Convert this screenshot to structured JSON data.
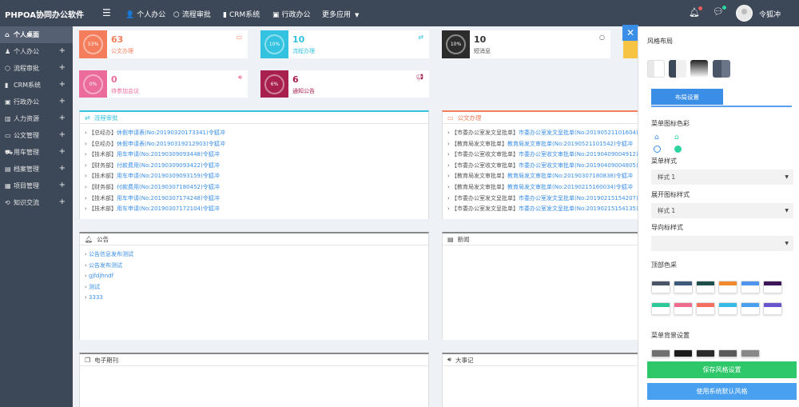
{
  "app": {
    "title": "PHPOA协同办公软件",
    "user": "令狐冲"
  },
  "topnav": [
    {
      "label": "个人办公",
      "icon": "user-icon"
    },
    {
      "label": "流程审批",
      "icon": "cube-icon"
    },
    {
      "label": "CRM系统",
      "icon": "bar-chart-icon"
    },
    {
      "label": "行政办公",
      "icon": "building-icon"
    },
    {
      "label": "更多应用",
      "icon": "caret-down-icon"
    }
  ],
  "sidebar": {
    "items": [
      {
        "label": "个人桌面"
      },
      {
        "label": "个人办公"
      },
      {
        "label": "流程审批"
      },
      {
        "label": "CRM系统"
      },
      {
        "label": "行政办公"
      },
      {
        "label": "人力资源"
      },
      {
        "label": "公文管理"
      },
      {
        "label": "用车管理"
      },
      {
        "label": "档案管理"
      },
      {
        "label": "项目管理"
      },
      {
        "label": "知识交流"
      }
    ]
  },
  "stats": [
    {
      "num": "63",
      "label": "公文办理",
      "pct": "53%"
    },
    {
      "num": "10",
      "label": "流程办理",
      "pct": "10%"
    },
    {
      "num": "10",
      "label": "短消息",
      "pct": "10%"
    },
    {
      "num": "0",
      "label": "待参加会议",
      "pct": "0%"
    },
    {
      "num": "6",
      "label": "通知公告",
      "pct": "6%"
    }
  ],
  "colors": {
    "orange": "#f47e5c",
    "cyan": "#33c3e0",
    "dark": "#2c2c2c",
    "pink": "#eb6b9b",
    "maroon": "#a8204e",
    "blue": "#3a8ee6",
    "green": "#2bd49e",
    "topbar": "#3c4757"
  },
  "panels": {
    "workflow": {
      "title": "流程审批",
      "items": [
        {
          "tag": "【总经办】",
          "text": "休假申请表(No:20190320173341)令狐冲"
        },
        {
          "tag": "【总经办】",
          "text": "休假申请表(No:20190319212903)令狐冲"
        },
        {
          "tag": "【技术部】",
          "text": "用车申请(No:20190309093448)令狐冲"
        },
        {
          "tag": "【财务部】",
          "text": "付款费用(No:20190309093422)令狐冲"
        },
        {
          "tag": "【技术部】",
          "text": "用车申请(No:20190309093159)令狐冲"
        },
        {
          "tag": "【财务部】",
          "text": "付款费用(No:20190307180452)令狐冲"
        },
        {
          "tag": "【技术部】",
          "text": "用车申请(No:20190307174248)令狐冲"
        },
        {
          "tag": "【技术部】",
          "text": "用车申请(No:20190307172104)令狐冲"
        }
      ]
    },
    "docs": {
      "title": "公文办理",
      "items": [
        {
          "tag": "【市委办公室发文呈批单】",
          "text": "市委办公室发文呈批单(No:20190521101604)令狐冲"
        },
        {
          "tag": "【教育局发文审批单】",
          "text": "教育局发文审批单(No:20190521101542)令狐冲"
        },
        {
          "tag": "【市委办公室收文审批单】",
          "text": "市委办公室收文审批单(No:20190409004912)令狐冲"
        },
        {
          "tag": "【市委办公室收文审批单】",
          "text": "市委办公室收文审批单(No:20190409004805)令狐冲"
        },
        {
          "tag": "【教育局发文审批单】",
          "text": "教育局发文审批单(No:20190307180838)令狐冲"
        },
        {
          "tag": "【教育局发文审批单】",
          "text": "教育局发文审批单(No:20190215160034)令狐冲"
        },
        {
          "tag": "【市委办公室发文呈批单】",
          "text": "市委办公室发文呈批单(No:20190215154207)令狐冲"
        },
        {
          "tag": "【市委办公室发文呈批单】",
          "text": "市委办公室发文呈批单(No:20190215154135)令狐冲"
        }
      ]
    },
    "notice": {
      "title": "公告",
      "items": [
        "公告信息发布测试",
        "公告发布测试",
        "gjfdjhndf",
        "测试",
        "3333"
      ]
    },
    "news": {
      "title": "新闻"
    },
    "ejournal": {
      "title": "电子期刊"
    },
    "events": {
      "title": "大事记"
    }
  },
  "style_panel": {
    "layout_title": "风格布局",
    "tab_label": "布局设置",
    "menu_icon_color_label": "菜单图标色彩",
    "menu_style_label": "菜单样式",
    "menu_style_value": "样式 1",
    "expand_icon_label": "展开图标样式",
    "expand_icon_value": "样式 1",
    "nav_icon_label": "导向标样式",
    "nav_icon_value": "",
    "top_color_label": "顶部色采",
    "menu_bg_label": "菜单背景设置",
    "save_button": "保存风格设置",
    "default_button": "使用系统默认风格",
    "top_colors": [
      "#4b5568",
      "#3d5a7a",
      "#1f4f4c",
      "#f28a30",
      "#4f95ef",
      "#3c1658",
      "#2ec99a",
      "#ef6b8e",
      "#f56f5e",
      "#35bbe6",
      "#4aa0f0",
      "#6a56cc"
    ],
    "bg_colors": [
      "#707070",
      "#1b1b1b",
      "#2a2a2a",
      "#5a5a5a",
      "#888888"
    ],
    "layout_swatches": [
      "#f0f0f0",
      "#3c4757",
      "#222222",
      "#4b5568"
    ]
  }
}
